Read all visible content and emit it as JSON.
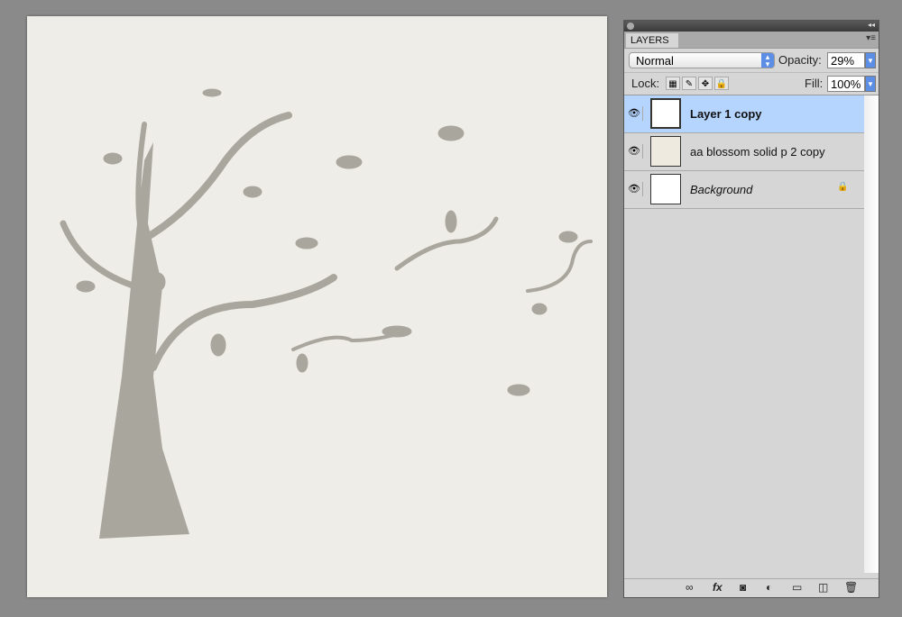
{
  "panel": {
    "tab": "LAYERS",
    "blend_mode": "Normal",
    "opacity_label": "Opacity:",
    "opacity": "29%",
    "lock_label": "Lock:",
    "fill_label": "Fill:",
    "fill": "100%"
  },
  "layers": [
    {
      "name": "Layer 1 copy",
      "selected": true,
      "visible": true,
      "locked": false
    },
    {
      "name": "aa blossom solid p 2 copy",
      "selected": false,
      "visible": true,
      "locked": false
    },
    {
      "name": "Background",
      "selected": false,
      "visible": true,
      "locked": true
    }
  ],
  "bottom_icons": [
    "link-icon",
    "fx-icon",
    "mask-icon",
    "adjustment-icon",
    "folder-icon",
    "new-layer-icon",
    "trash-icon"
  ],
  "colors": {
    "selection": "#b5d5fe",
    "accent": "#5c8ee6",
    "silhouette": "#a9a69e"
  }
}
